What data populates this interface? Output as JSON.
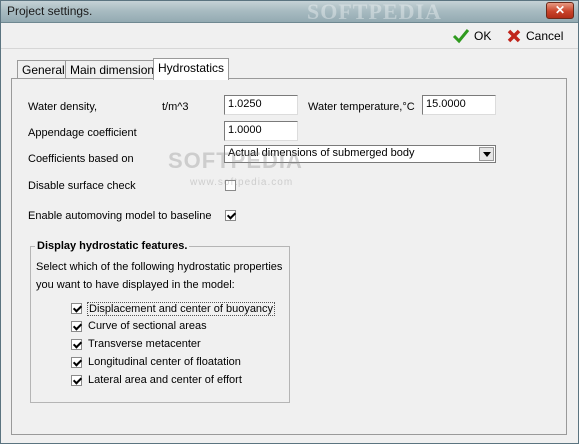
{
  "window": {
    "title": "Project settings.",
    "watermark_title": "SOFTPEDIA",
    "close_glyph": "✕"
  },
  "toolbar": {
    "ok_label": "OK",
    "cancel_label": "Cancel"
  },
  "tabs": [
    {
      "label": "General",
      "active": false
    },
    {
      "label": "Main dimensions",
      "active": false
    },
    {
      "label": "Hydrostatics",
      "active": true
    }
  ],
  "form": {
    "water_density_label": "Water density,",
    "water_density_unit": "t/m^3",
    "water_density_value": "1.0250",
    "water_temperature_label": "Water temperature,°C",
    "water_temperature_value": "15.0000",
    "appendage_label": "Appendage coefficient",
    "appendage_value": "1.0000",
    "coefficients_label": "Coefficients based on",
    "coefficients_value": "Actual dimensions of submerged body",
    "disable_surface_label": "Disable surface check",
    "disable_surface_checked": false,
    "automoving_label": "Enable automoving model to baseline",
    "automoving_checked": true
  },
  "group": {
    "title": "Display hydrostatic features.",
    "desc_line1": "Select which of the following hydrostatic properties",
    "desc_line2": "you want to have displayed in the model:",
    "items": [
      {
        "label": "Displacement and center of buoyancy",
        "checked": true
      },
      {
        "label": "Curve of sectional areas",
        "checked": true
      },
      {
        "label": "Transverse metacenter",
        "checked": true
      },
      {
        "label": "Longitudinal center of floatation",
        "checked": true
      },
      {
        "label": "Lateral area and center of effort",
        "checked": true
      }
    ]
  },
  "watermark": {
    "text": "SOFTPEDIA",
    "url": "www.softpedia.com"
  }
}
